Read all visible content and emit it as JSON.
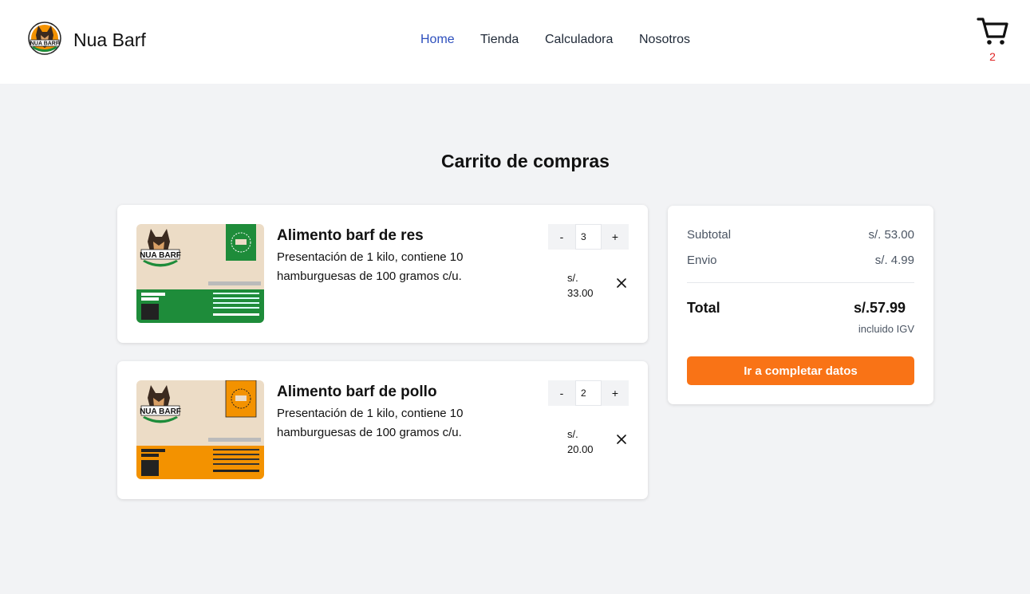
{
  "header": {
    "brand": "Nua Barf",
    "logo_icon": "dog-logo-icon",
    "nav": [
      "Home",
      "Tienda",
      "Calculadora",
      "Nosotros"
    ],
    "active_nav": "Home",
    "cart_count": "2",
    "cart_icon": "shopping-cart-icon"
  },
  "page": {
    "title": "Carrito de compras"
  },
  "cart_items": [
    {
      "name": "Alimento barf de res",
      "description": "Presentación de 1 kilo, contiene 10 hamburguesas de 100 gramos c/u.",
      "quantity": "3",
      "price": "s/. 33.00",
      "decrement_label": "-",
      "increment_label": "+",
      "image": {
        "brand_text": "NUA BARF",
        "recipe_label": "RECETA RES",
        "accent_color": "#1e8c3a"
      }
    },
    {
      "name": "Alimento barf de pollo",
      "description": "Presentación de 1 kilo, contiene 10 hamburguesas de 100 gramos c/u.",
      "quantity": "2",
      "price": "s/. 20.00",
      "decrement_label": "-",
      "increment_label": "+",
      "image": {
        "brand_text": "NUA BARF",
        "recipe_label": "RECETA POLLO",
        "accent_color": "#f39200"
      }
    }
  ],
  "summary": {
    "subtotal_label": "Subtotal",
    "subtotal_value": "s/. 53.00",
    "shipping_label": "Envio",
    "shipping_value": "s/. 4.99",
    "total_label": "Total",
    "total_value": "s/.57.99",
    "tax_note": "incluido IGV",
    "cta_label": "Ir a completar datos"
  },
  "colors": {
    "accent": "#f97316",
    "nav_active": "#2d4fbd",
    "cart_count": "#e02424",
    "background": "#f2f3f5"
  }
}
